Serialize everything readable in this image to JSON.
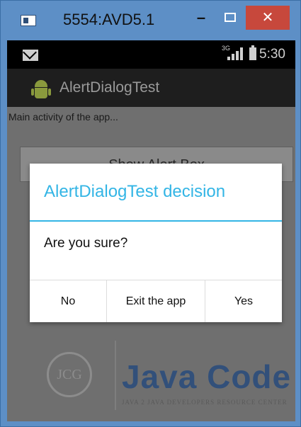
{
  "window": {
    "title": "5554:AVD5.1",
    "minimize_label": "–",
    "close_label": "✕",
    "icons": [
      "app-icon",
      "minimize-icon",
      "maximize-icon",
      "close-icon"
    ]
  },
  "statusbar": {
    "network_type": "3G",
    "time": "5:30",
    "icons": [
      "mail-icon",
      "signal-icon",
      "battery-icon"
    ]
  },
  "actionbar": {
    "app_title": "AlertDialogTest",
    "icon": "android-icon"
  },
  "content": {
    "activity_text": "Main activity of the app...",
    "show_alert_label": "Show Alert Box"
  },
  "dialog": {
    "title": "AlertDialogTest decision",
    "message": "Are you sure?",
    "buttons": {
      "no": "No",
      "exit": "Exit the app",
      "yes": "Yes"
    },
    "accent_color": "#33b5e5"
  },
  "watermark": {
    "logo_text": "JCG",
    "name": "Java Code Geeks",
    "tagline": "JAVA 2 JAVA DEVELOPERS RESOURCE CENTER"
  },
  "colors": {
    "window_frame": "#5d8fc6",
    "close_button": "#c7483c",
    "dim_overlay": "#6f6f6f",
    "statusbar": "#000000",
    "actionbar": "#1e1e1e"
  }
}
